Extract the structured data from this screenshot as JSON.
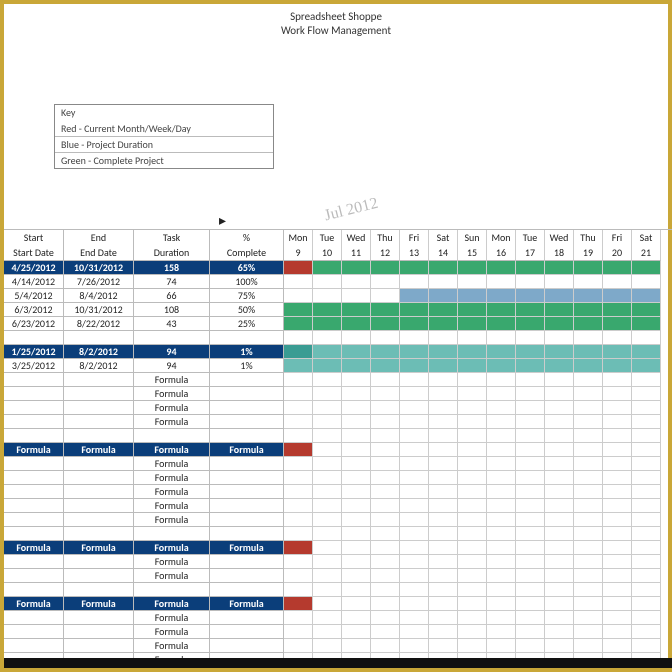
{
  "header": {
    "line1": "Spreadsheet Shoppe",
    "line2": "Work Flow Management"
  },
  "key": {
    "title": "Key",
    "items": [
      "Red - Current Month/Week/Day",
      "Blue - Project Duration",
      "Green - Complete Project"
    ]
  },
  "month_label": "Jul 2012",
  "columns": {
    "left_top": [
      "Start",
      "End",
      "Task",
      "%"
    ],
    "left_bottom": [
      "Start Date",
      "End Date",
      "Duration",
      "Complete"
    ],
    "days_top": [
      "Mon",
      "Tue",
      "Wed",
      "Thu",
      "Fri",
      "Sat",
      "Sun",
      "Mon",
      "Tue",
      "Wed",
      "Thu",
      "Fri",
      "Sat"
    ],
    "days_bottom": [
      "9",
      "10",
      "11",
      "12",
      "13",
      "14",
      "15",
      "16",
      "17",
      "18",
      "19",
      "20",
      "21"
    ]
  },
  "rows": [
    {
      "type": "blue",
      "start": "4/25/2012",
      "end": "10/31/2012",
      "dur": "158",
      "pct": "65%",
      "bars": [
        "red",
        "green",
        "green",
        "green",
        "green",
        "green",
        "green",
        "green",
        "green",
        "green",
        "green",
        "green",
        "green"
      ]
    },
    {
      "type": "plain",
      "start": "4/14/2012",
      "end": "7/26/2012",
      "dur": "74",
      "pct": "100%",
      "bars": [
        "",
        "",
        "",
        "",
        "",
        "",
        "",
        "",
        "",
        "",
        "",
        "",
        ""
      ]
    },
    {
      "type": "plain",
      "start": "5/4/2012",
      "end": "8/4/2012",
      "dur": "66",
      "pct": "75%",
      "bars": [
        "",
        "",
        "",
        "",
        "blue",
        "blue",
        "blue",
        "blue",
        "blue",
        "blue",
        "blue",
        "blue",
        "blue"
      ]
    },
    {
      "type": "plain",
      "start": "6/3/2012",
      "end": "10/31/2012",
      "dur": "108",
      "pct": "50%",
      "bars": [
        "green",
        "green",
        "green",
        "green",
        "green",
        "green",
        "green",
        "green",
        "green",
        "green",
        "green",
        "green",
        "green"
      ]
    },
    {
      "type": "plain",
      "start": "6/23/2012",
      "end": "8/22/2012",
      "dur": "43",
      "pct": "25%",
      "bars": [
        "green",
        "green",
        "green",
        "green",
        "green",
        "green",
        "green",
        "green",
        "green",
        "green",
        "green",
        "green",
        "green"
      ]
    },
    {
      "type": "empty",
      "start": "",
      "end": "",
      "dur": "",
      "pct": "",
      "bars": [
        "",
        "",
        "",
        "",
        "",
        "",
        "",
        "",
        "",
        "",
        "",
        "",
        ""
      ]
    },
    {
      "type": "blue",
      "start": "1/25/2012",
      "end": "8/2/2012",
      "dur": "94",
      "pct": "1%",
      "bars": [
        "teal",
        "tealL",
        "tealL",
        "tealL",
        "tealL",
        "tealL",
        "tealL",
        "tealL",
        "tealL",
        "tealL",
        "tealL",
        "tealL",
        "tealL"
      ]
    },
    {
      "type": "plain",
      "start": "3/25/2012",
      "end": "8/2/2012",
      "dur": "94",
      "pct": "1%",
      "bars": [
        "tealL",
        "tealL",
        "tealL",
        "tealL",
        "tealL",
        "tealL",
        "tealL",
        "tealL",
        "tealL",
        "tealL",
        "tealL",
        "tealL",
        "tealL"
      ]
    },
    {
      "type": "plain",
      "start": "",
      "end": "",
      "dur": "Formula",
      "pct": "",
      "bars": [
        "",
        "",
        "",
        "",
        "",
        "",
        "",
        "",
        "",
        "",
        "",
        "",
        ""
      ]
    },
    {
      "type": "plain",
      "start": "",
      "end": "",
      "dur": "Formula",
      "pct": "",
      "bars": [
        "",
        "",
        "",
        "",
        "",
        "",
        "",
        "",
        "",
        "",
        "",
        "",
        ""
      ]
    },
    {
      "type": "plain",
      "start": "",
      "end": "",
      "dur": "Formula",
      "pct": "",
      "bars": [
        "",
        "",
        "",
        "",
        "",
        "",
        "",
        "",
        "",
        "",
        "",
        "",
        ""
      ]
    },
    {
      "type": "plain",
      "start": "",
      "end": "",
      "dur": "Formula",
      "pct": "",
      "bars": [
        "",
        "",
        "",
        "",
        "",
        "",
        "",
        "",
        "",
        "",
        "",
        "",
        ""
      ]
    },
    {
      "type": "empty",
      "start": "",
      "end": "",
      "dur": "",
      "pct": "",
      "bars": [
        "",
        "",
        "",
        "",
        "",
        "",
        "",
        "",
        "",
        "",
        "",
        "",
        ""
      ]
    },
    {
      "type": "blue",
      "start": "Formula",
      "end": "Formula",
      "dur": "Formula",
      "pct": "Formula",
      "bars": [
        "red",
        "",
        "",
        "",
        "",
        "",
        "",
        "",
        "",
        "",
        "",
        "",
        ""
      ]
    },
    {
      "type": "plain",
      "start": "",
      "end": "",
      "dur": "Formula",
      "pct": "",
      "bars": [
        "",
        "",
        "",
        "",
        "",
        "",
        "",
        "",
        "",
        "",
        "",
        "",
        ""
      ]
    },
    {
      "type": "plain",
      "start": "",
      "end": "",
      "dur": "Formula",
      "pct": "",
      "bars": [
        "",
        "",
        "",
        "",
        "",
        "",
        "",
        "",
        "",
        "",
        "",
        "",
        ""
      ]
    },
    {
      "type": "plain",
      "start": "",
      "end": "",
      "dur": "Formula",
      "pct": "",
      "bars": [
        "",
        "",
        "",
        "",
        "",
        "",
        "",
        "",
        "",
        "",
        "",
        "",
        ""
      ]
    },
    {
      "type": "plain",
      "start": "",
      "end": "",
      "dur": "Formula",
      "pct": "",
      "bars": [
        "",
        "",
        "",
        "",
        "",
        "",
        "",
        "",
        "",
        "",
        "",
        "",
        ""
      ]
    },
    {
      "type": "plain",
      "start": "",
      "end": "",
      "dur": "Formula",
      "pct": "",
      "bars": [
        "",
        "",
        "",
        "",
        "",
        "",
        "",
        "",
        "",
        "",
        "",
        "",
        ""
      ]
    },
    {
      "type": "empty",
      "start": "",
      "end": "",
      "dur": "",
      "pct": "",
      "bars": [
        "",
        "",
        "",
        "",
        "",
        "",
        "",
        "",
        "",
        "",
        "",
        "",
        ""
      ]
    },
    {
      "type": "blue",
      "start": "Formula",
      "end": "Formula",
      "dur": "Formula",
      "pct": "Formula",
      "bars": [
        "red",
        "",
        "",
        "",
        "",
        "",
        "",
        "",
        "",
        "",
        "",
        "",
        ""
      ]
    },
    {
      "type": "plain",
      "start": "",
      "end": "",
      "dur": "Formula",
      "pct": "",
      "bars": [
        "",
        "",
        "",
        "",
        "",
        "",
        "",
        "",
        "",
        "",
        "",
        "",
        ""
      ]
    },
    {
      "type": "plain",
      "start": "",
      "end": "",
      "dur": "Formula",
      "pct": "",
      "bars": [
        "",
        "",
        "",
        "",
        "",
        "",
        "",
        "",
        "",
        "",
        "",
        "",
        ""
      ]
    },
    {
      "type": "empty",
      "start": "",
      "end": "",
      "dur": "",
      "pct": "",
      "bars": [
        "",
        "",
        "",
        "",
        "",
        "",
        "",
        "",
        "",
        "",
        "",
        "",
        ""
      ]
    },
    {
      "type": "blue",
      "start": "Formula",
      "end": "Formula",
      "dur": "Formula",
      "pct": "Formula",
      "bars": [
        "red",
        "",
        "",
        "",
        "",
        "",
        "",
        "",
        "",
        "",
        "",
        "",
        ""
      ]
    },
    {
      "type": "plain",
      "start": "",
      "end": "",
      "dur": "Formula",
      "pct": "",
      "bars": [
        "",
        "",
        "",
        "",
        "",
        "",
        "",
        "",
        "",
        "",
        "",
        "",
        ""
      ]
    },
    {
      "type": "plain",
      "start": "",
      "end": "",
      "dur": "Formula",
      "pct": "",
      "bars": [
        "",
        "",
        "",
        "",
        "",
        "",
        "",
        "",
        "",
        "",
        "",
        "",
        ""
      ]
    },
    {
      "type": "plain",
      "start": "",
      "end": "",
      "dur": "Formula",
      "pct": "",
      "bars": [
        "",
        "",
        "",
        "",
        "",
        "",
        "",
        "",
        "",
        "",
        "",
        "",
        ""
      ]
    },
    {
      "type": "plain",
      "start": "",
      "end": "",
      "dur": "Formula",
      "pct": "",
      "bars": [
        "",
        "",
        "",
        "",
        "",
        "",
        "",
        "",
        "",
        "",
        "",
        "",
        ""
      ]
    }
  ]
}
